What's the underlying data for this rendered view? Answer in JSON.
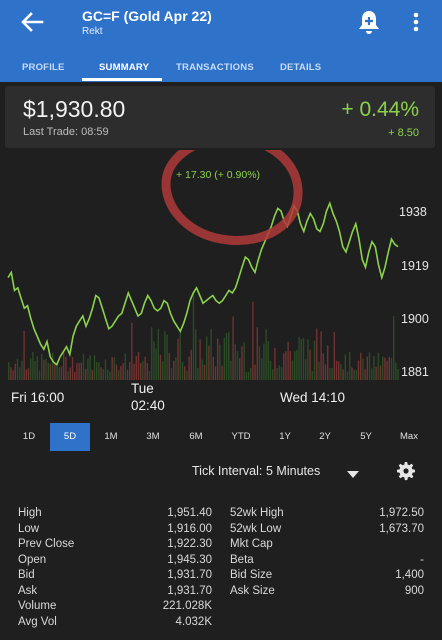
{
  "header": {
    "title": "GC=F (Gold Apr 22)",
    "subtitle": "Rekt",
    "tabs": [
      "PROFILE",
      "SUMMARY",
      "TRANSACTIONS",
      "DETAILS"
    ],
    "active_tab": "SUMMARY"
  },
  "quote": {
    "price": "$1,930.80",
    "last_trade": "Last Trade: 08:59",
    "change_pct": "+ 0.44%",
    "change": "+ 8.50",
    "color_up": "#8bd24c"
  },
  "chart_data": {
    "type": "line",
    "annotation": "+ 17.30 (+ 0.90%)",
    "y_ticks": [
      1938,
      1919,
      1900,
      1881
    ],
    "ylim": [
      1878,
      1960
    ],
    "x_tick_labels": [
      "Fri 16:00",
      "Tue\n02:40",
      "Wed 14:10"
    ],
    "series": [
      {
        "values": [
          1918,
          1920,
          1913,
          1914,
          1910,
          1906,
          1907,
          1902,
          1898,
          1895,
          1892,
          1890,
          1893,
          1887,
          1885,
          1884,
          1887,
          1889,
          1891,
          1888,
          1895,
          1899,
          1901,
          1903,
          1899,
          1902,
          1906,
          1911,
          1910,
          1906,
          1902,
          1898,
          1899,
          1901,
          1903,
          1904,
          1908,
          1912,
          1909,
          1906,
          1903,
          1904,
          1908,
          1911,
          1909,
          1906,
          1905,
          1906,
          1909,
          1908,
          1904,
          1901,
          1899,
          1897,
          1900,
          1904,
          1909,
          1912,
          1914,
          1911,
          1908,
          1909,
          1910,
          1911,
          1909,
          1908,
          1909,
          1911,
          1913,
          1912,
          1914,
          1918,
          1922,
          1926,
          1925,
          1922,
          1920,
          1925,
          1929,
          1932,
          1935,
          1938,
          1942,
          1945,
          1944,
          1940,
          1938,
          1942,
          1946,
          1944,
          1939,
          1936,
          1940,
          1943,
          1941,
          1937,
          1936,
          1939,
          1944,
          1947,
          1943,
          1940,
          1936,
          1930,
          1928,
          1932,
          1936,
          1939,
          1933,
          1925,
          1922,
          1928,
          1932,
          1930,
          1923,
          1918,
          1922,
          1928,
          1933,
          1931,
          1930
        ]
      }
    ],
    "line_color": "#8bd24c",
    "volume_color": "#8d3a3a",
    "grid": false
  },
  "ranges": {
    "items": [
      "1D",
      "5D",
      "1M",
      "3M",
      "6M",
      "YTD",
      "1Y",
      "2Y",
      "5Y",
      "Max"
    ],
    "active": "5D"
  },
  "tick_interval": {
    "label": "Tick Interval:",
    "value": "5 Minutes"
  },
  "stats": {
    "left": [
      {
        "label": "High",
        "value": "1,951.40"
      },
      {
        "label": "Low",
        "value": "1,916.00"
      },
      {
        "label": "Prev Close",
        "value": "1,922.30"
      },
      {
        "label": "Open",
        "value": "1,945.30"
      },
      {
        "label": "Bid",
        "value": "1,931.70"
      },
      {
        "label": "Ask",
        "value": "1,931.70"
      },
      {
        "label": "Volume",
        "value": "221.028K"
      },
      {
        "label": "Avg Vol",
        "value": "4.032K"
      }
    ],
    "right": [
      {
        "label": "52wk High",
        "value": "1,972.50"
      },
      {
        "label": "52wk Low",
        "value": "1,673.70"
      },
      {
        "label": "Mkt Cap",
        "value": ""
      },
      {
        "label": "Beta",
        "value": "-"
      },
      {
        "label": "Bid Size",
        "value": "1,400"
      },
      {
        "label": "Ask Size",
        "value": "900"
      }
    ]
  },
  "icons": {
    "back": "arrow-left-icon",
    "bell": "bell-plus-icon",
    "more": "more-vertical-icon",
    "dropdown": "caret-down-icon",
    "settings": "gear-icon"
  }
}
